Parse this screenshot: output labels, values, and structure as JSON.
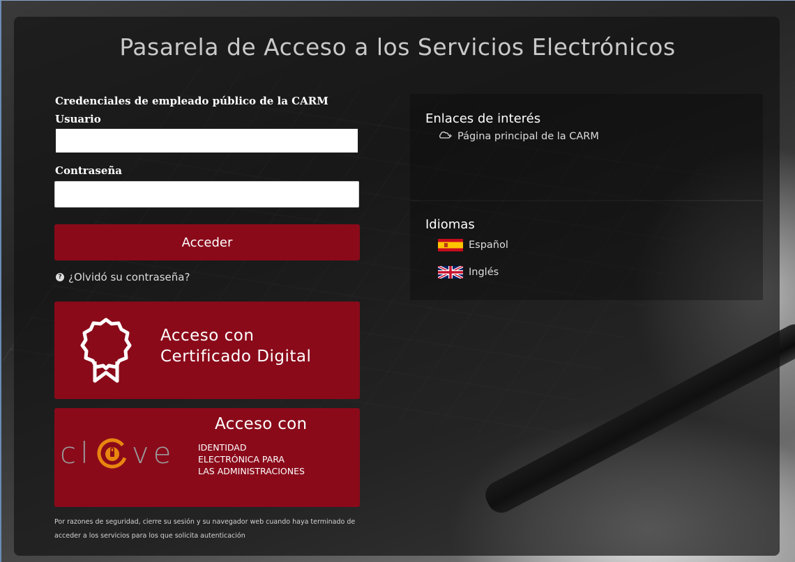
{
  "page": {
    "title": "Pasarela de Acceso a los Servicios Electrónicos"
  },
  "login": {
    "credentials_heading": "Credenciales de empleado público de la CARM",
    "user_label": "Usuario",
    "user_value": "",
    "password_label": "Contraseña",
    "password_value": "",
    "submit_label": "Acceder",
    "forgot_label": "¿Olvidó su contraseña?",
    "forgot_icon": "question-circle-icon"
  },
  "certificate_tile": {
    "line1": "Acceso con",
    "line2": "Certificado Digital",
    "icon": "certificate-ribbon-icon"
  },
  "clave_tile": {
    "title": "Acceso con",
    "logo_text_left": "cl",
    "logo_text_right": "ve",
    "subtitle_line1": "IDENTIDAD",
    "subtitle_line2": "ELECTRÓNICA PARA",
    "subtitle_line3": "LAS ADMINISTRACIONES"
  },
  "security_notice": "Por razones de seguridad, cierre su sesión y su navegador web cuando haya terminado de acceder a los servicios para los que solicita autenticación",
  "links": {
    "title": "Enlaces de interés",
    "items": [
      {
        "label": "Página principal de la CARM",
        "icon": "cloud-icon"
      }
    ]
  },
  "languages": {
    "title": "Idiomas",
    "items": [
      {
        "label": "Español",
        "icon": "spain-flag-icon"
      },
      {
        "label": "Inglés",
        "icon": "uk-flag-icon"
      }
    ]
  },
  "colors": {
    "accent": "#8a0a1a",
    "clave_orange": "#e8860f"
  }
}
